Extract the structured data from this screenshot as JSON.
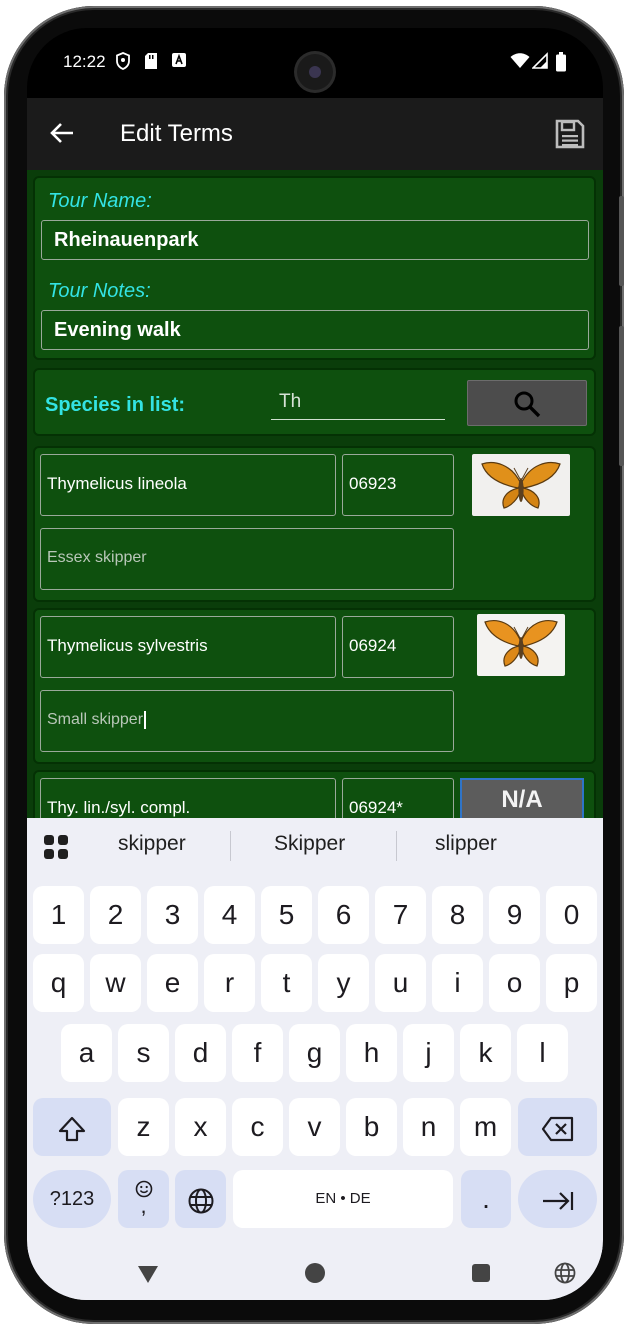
{
  "status_bar": {
    "time": "12:22"
  },
  "app_bar": {
    "title": "Edit Terms"
  },
  "tour": {
    "name_label": "Tour Name:",
    "name_value": "Rheinauenpark",
    "notes_label": "Tour Notes:",
    "notes_value": "Evening walk"
  },
  "species_search": {
    "label": "Species in list:",
    "query": "Th"
  },
  "species": [
    {
      "scientific": "Thymelicus lineola",
      "code": "06923",
      "common": "Essex skipper",
      "image": "butterfly"
    },
    {
      "scientific": "Thymelicus sylvestris",
      "code": "06924",
      "common": "Small skipper",
      "image": "butterfly"
    },
    {
      "scientific": "Thy. lin./syl. compl.",
      "code": "06924*",
      "image_text": "N/A"
    }
  ],
  "keyboard": {
    "suggestions": [
      "skipper",
      "Skipper",
      "slipper"
    ],
    "row_numbers": [
      "1",
      "2",
      "3",
      "4",
      "5",
      "6",
      "7",
      "8",
      "9",
      "0"
    ],
    "row_top": [
      "q",
      "w",
      "e",
      "r",
      "t",
      "y",
      "u",
      "i",
      "o",
      "p"
    ],
    "row_mid": [
      "a",
      "s",
      "d",
      "f",
      "g",
      "h",
      "j",
      "k",
      "l"
    ],
    "row_bottom": [
      "z",
      "x",
      "c",
      "v",
      "b",
      "n",
      "m"
    ],
    "symbols_key": "?123",
    "emoji_comma": ",",
    "space_label": "EN • DE",
    "period": "."
  },
  "colors": {
    "background": "#0a3d0a",
    "card": "#0e500e",
    "label_cyan": "#33e3e3",
    "app_bar": "#1b1b1b",
    "keyboard_bg": "#eeeff6",
    "key_mod": "#d7def4"
  },
  "icons": [
    "back-arrow-icon",
    "save-icon",
    "search-icon",
    "shift-icon",
    "backspace-icon",
    "globe-icon",
    "enter-icon",
    "emoji-icon",
    "apps-grid-icon"
  ]
}
